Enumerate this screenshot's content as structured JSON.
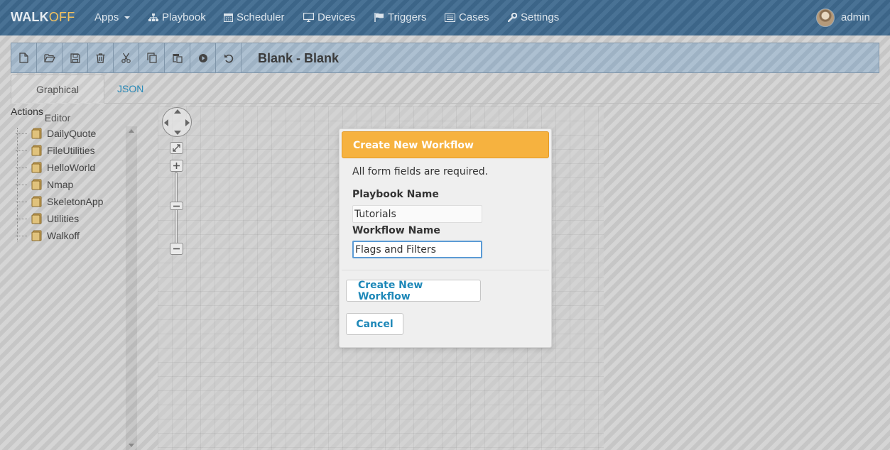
{
  "navbar": {
    "brand_part1": "WALK",
    "brand_part2": "OFF",
    "items": [
      {
        "label": "Apps",
        "icon": "caret-down-icon"
      },
      {
        "label": "Playbook",
        "icon": "sitemap-icon"
      },
      {
        "label": "Scheduler",
        "icon": "calendar-icon"
      },
      {
        "label": "Devices",
        "icon": "monitor-icon"
      },
      {
        "label": "Triggers",
        "icon": "flag-icon"
      },
      {
        "label": "Cases",
        "icon": "list-icon"
      },
      {
        "label": "Settings",
        "icon": "wrench-icon"
      }
    ],
    "user": "admin"
  },
  "toolbar": {
    "buttons": [
      "new-file-icon",
      "open-folder-icon",
      "save-icon",
      "delete-icon",
      "cut-icon",
      "copy-icon",
      "paste-icon",
      "execute-icon",
      "undo-icon"
    ],
    "title": "Blank - Blank"
  },
  "tabs": {
    "graphical": "Graphical Editor",
    "json": "JSON"
  },
  "actions": {
    "title": "Actions",
    "apps": [
      "DailyQuote",
      "FileUtilities",
      "HelloWorld",
      "Nmap",
      "SkeletonApp",
      "Utilities",
      "Walkoff"
    ]
  },
  "modal": {
    "title": "Create New Workflow",
    "note": "All form fields are required.",
    "playbook_label": "Playbook Name",
    "playbook_value": "Tutorials",
    "workflow_label": "Workflow Name",
    "workflow_value": "Flags and Filters",
    "submit_label": "Create New Workflow",
    "cancel_label": "Cancel"
  },
  "colors": {
    "navbar": "#3f6a8f",
    "modal_header": "#f6b23f",
    "link": "#2a8ab8"
  }
}
